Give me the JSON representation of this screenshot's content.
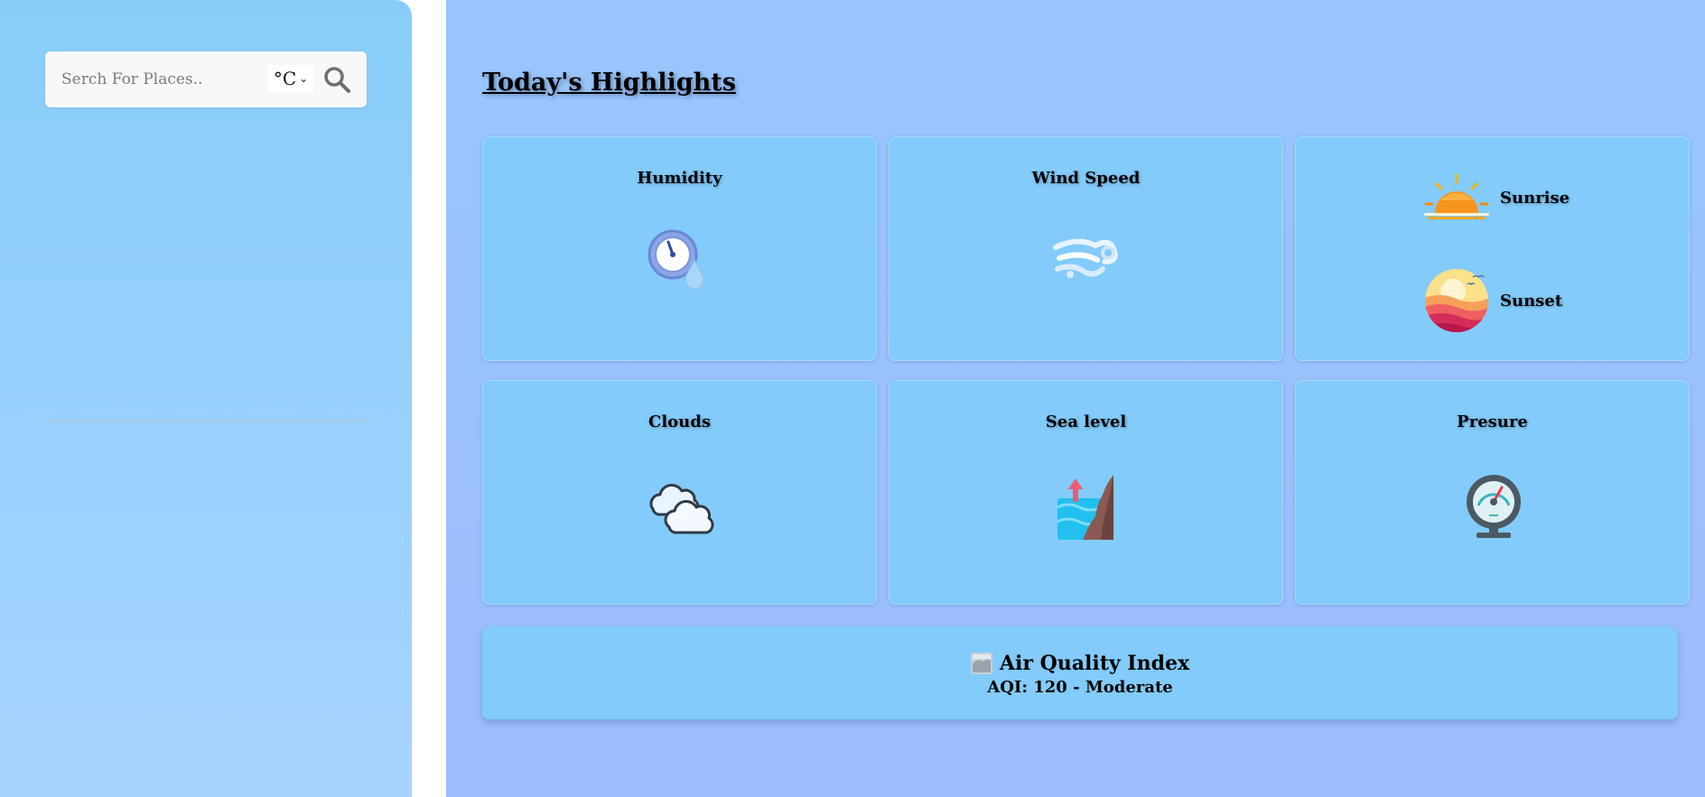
{
  "search": {
    "placeholder": "Serch For Places..",
    "unit_selected": "°C",
    "unit_options": [
      "°C"
    ]
  },
  "highlights": {
    "title": "Today's Highlights",
    "humidity": {
      "label": "Humidity",
      "icon": "humidity-icon"
    },
    "wind_speed": {
      "label": "Wind Speed",
      "icon": "wind-icon"
    },
    "sunrise": {
      "label": "Sunrise",
      "icon": "sunrise-icon"
    },
    "sunset": {
      "label": "Sunset",
      "icon": "sunset-icon"
    },
    "clouds": {
      "label": "Clouds",
      "icon": "clouds-icon"
    },
    "sea_level": {
      "label": "Sea level",
      "icon": "sea-level-icon"
    },
    "pressure": {
      "label": "Presure",
      "icon": "pressure-gauge-icon"
    }
  },
  "aqi": {
    "title": "Air Quality Index",
    "value_text": "AQI: 120 - Moderate",
    "icon": "fog-icon"
  },
  "colors": {
    "sidebar_top": "#88cdfa",
    "main_bg": "#98c6fd",
    "card_bg": "#82cbfb"
  }
}
